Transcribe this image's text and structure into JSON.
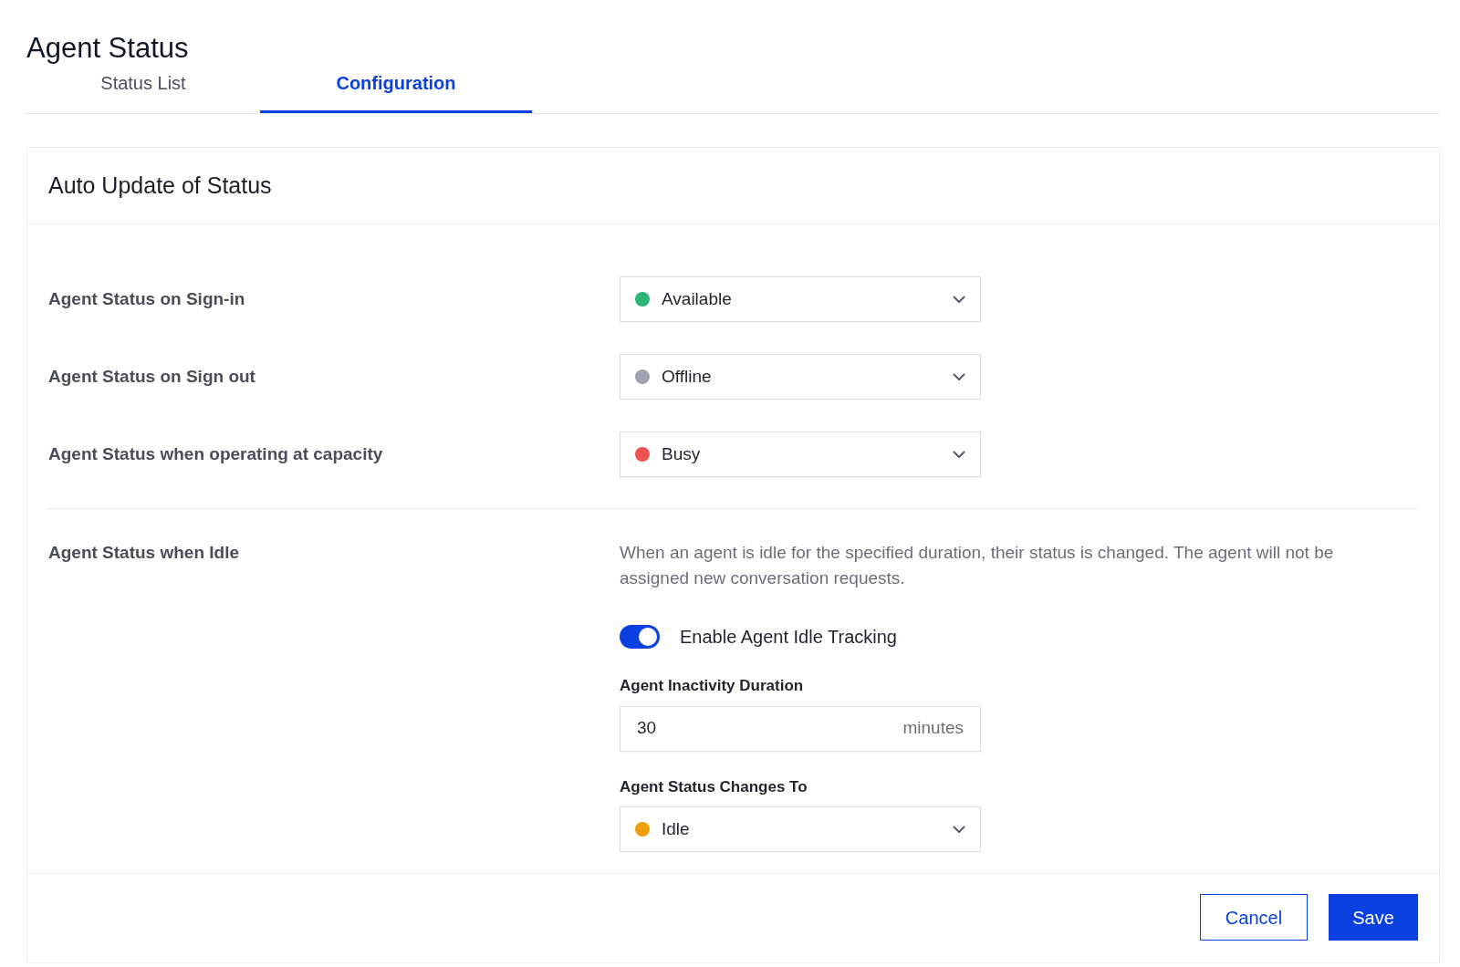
{
  "page": {
    "title": "Agent Status"
  },
  "tabs": [
    {
      "label": "Status List",
      "selected": false
    },
    {
      "label": "Configuration",
      "selected": true
    }
  ],
  "card": {
    "title": "Auto Update of Status"
  },
  "status_rows": [
    {
      "label": "Agent Status on Sign-in",
      "value": "Available",
      "color": "#2bb673"
    },
    {
      "label": "Agent Status on Sign out",
      "value": "Offline",
      "color": "#9ea3ae"
    },
    {
      "label": "Agent Status when operating at capacity",
      "value": "Busy",
      "color": "#ee5253"
    }
  ],
  "idle": {
    "label": "Agent Status when Idle",
    "description": "When an agent is idle for the specified duration, their status is changed. The agent will not be assigned new conversation requests.",
    "toggle": {
      "label": "Enable Agent Idle Tracking",
      "on": true
    },
    "duration": {
      "label": "Agent Inactivity Duration",
      "value": "30",
      "unit": "minutes"
    },
    "changes_to": {
      "label": "Agent Status Changes To",
      "value": "Idle",
      "color": "#eea10c"
    }
  },
  "buttons": [
    {
      "label": "Cancel",
      "kind": "secondary"
    },
    {
      "label": "Save",
      "kind": "primary"
    }
  ]
}
